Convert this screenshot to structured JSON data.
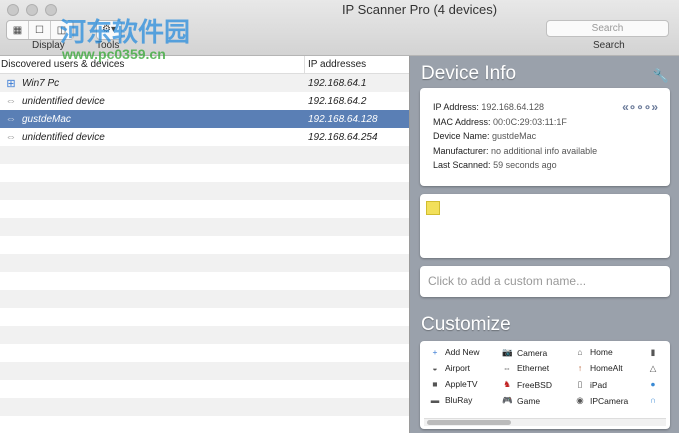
{
  "window": {
    "title": "IP Scanner Pro (4 devices)"
  },
  "toolbar": {
    "display_label": "Display",
    "tools_label": "Tools",
    "tools_glyph": "⚙▾",
    "search_placeholder": "Search",
    "search_label": "Search"
  },
  "list": {
    "col_devices": "Discovered users & devices",
    "col_ip": "IP addresses",
    "rows": [
      {
        "name": "Win7 Pc",
        "ip": "192.168.64.1",
        "icon": "windows-icon"
      },
      {
        "name": "unidentified device",
        "ip": "192.168.64.2",
        "icon": "ethernet-icon"
      },
      {
        "name": "gustdeMac",
        "ip": "192.168.64.128",
        "icon": "ethernet-icon",
        "selected": true
      },
      {
        "name": "unidentified device",
        "ip": "192.168.64.254",
        "icon": "ethernet-icon"
      }
    ]
  },
  "device_info": {
    "heading": "Device Info",
    "ip_label": "IP Address:",
    "ip": "192.168.64.128",
    "mac_label": "MAC Address:",
    "mac": "00:0C:29:03:11:1F",
    "name_label": "Device Name:",
    "name": "gustdeMac",
    "mfr_label": "Manufacturer:",
    "mfr": "no additional info available",
    "scan_label": "Last Scanned:",
    "scan": "59 seconds ago",
    "custom_name_placeholder": "Click to add a custom name..."
  },
  "customize": {
    "heading": "Customize",
    "items": [
      "Add New",
      "Camera",
      "Home",
      "Airport",
      "Ethernet",
      "HomeAlt",
      "AppleTV",
      "FreeBSD",
      "iPad",
      "BluRay",
      "Game",
      "IPCamera"
    ]
  },
  "watermark": {
    "text": "河东软件园",
    "url": "www.pc0359.cn"
  }
}
